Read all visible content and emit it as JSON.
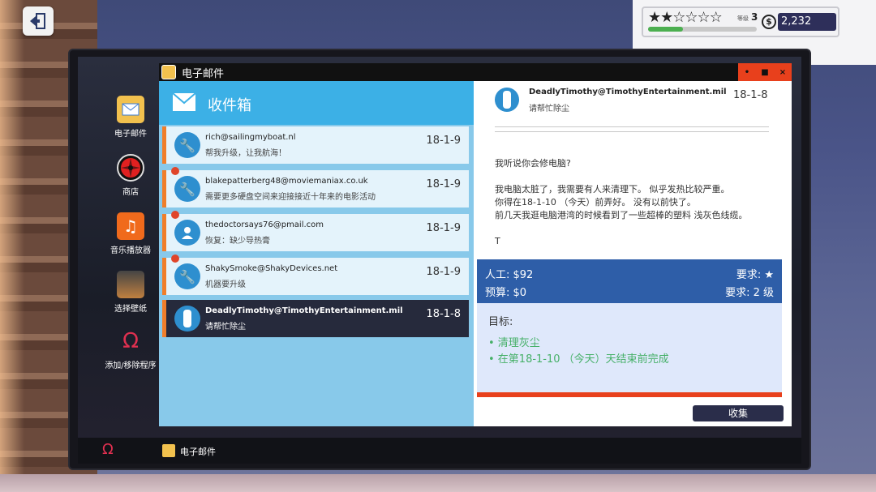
{
  "hud": {
    "stars": "★★☆☆☆☆",
    "level_label": "等级",
    "level": "3",
    "xp_fraction": 0.32,
    "coin": "$",
    "money": "2,232"
  },
  "desktop": {
    "icons": [
      {
        "label": "电子邮件",
        "icon": "email-icon"
      },
      {
        "label": "商店",
        "icon": "shop-fan-icon"
      },
      {
        "label": "音乐播放器",
        "icon": "music-icon"
      },
      {
        "label": "选择壁纸",
        "icon": "wallpaper-icon"
      },
      {
        "label": "添加/移除程序",
        "icon": "omega-icon"
      }
    ]
  },
  "taskbar": {
    "app_label": "电子邮件"
  },
  "window": {
    "title": "电子邮件",
    "controls": [
      "•",
      "■",
      "×"
    ]
  },
  "inbox": {
    "title": "收件箱",
    "items": [
      {
        "from": "rich@sailingmyboat.nl",
        "subject": "帮我升级，让我航海！",
        "date": "18-1-9",
        "unread": false
      },
      {
        "from": "blakepatterberg48@moviemaniax.co.uk",
        "subject": "需要更多硬盘空间来迎接接近十年来的电影活动",
        "date": "18-1-9",
        "unread": true
      },
      {
        "from": "thedoctorsays76@pmail.com",
        "subject": "恢复：缺少导热膏",
        "date": "18-1-9",
        "unread": true
      },
      {
        "from": "ShakySmoke@ShakyDevices.net",
        "subject": "机器要升级",
        "date": "18-1-9",
        "unread": true
      },
      {
        "from": "DeadlyTimothy@TimothyEntertainment.mil",
        "subject": "请帮忙除尘",
        "date": "18-1-8",
        "unread": false
      }
    ]
  },
  "message": {
    "from": "DeadlyTimothy@TimothyEntertainment.mil",
    "subject": "请帮忙除尘",
    "date": "18-1-8",
    "body": [
      "我听说你会修电脑?",
      "",
      "我电脑太脏了，我需要有人来清理下。 似乎发热比较严重。",
      "你得在18-1-10 （今天）前弄好。 没有以前快了。",
      "前几天我逛电脑港湾的时候看到了一些超棒的塑料 浅灰色线缆。",
      "",
      "T"
    ],
    "labor": "人工: $92",
    "budget": "预算: $0",
    "req_stars": "要求: ★",
    "req_level": "要求: 2 级",
    "goals_label": "目标:",
    "goals": [
      "• 清理灰尘",
      "• 在第18-1-10 （今天）天结束前完成"
    ],
    "collect_label": "收集"
  }
}
